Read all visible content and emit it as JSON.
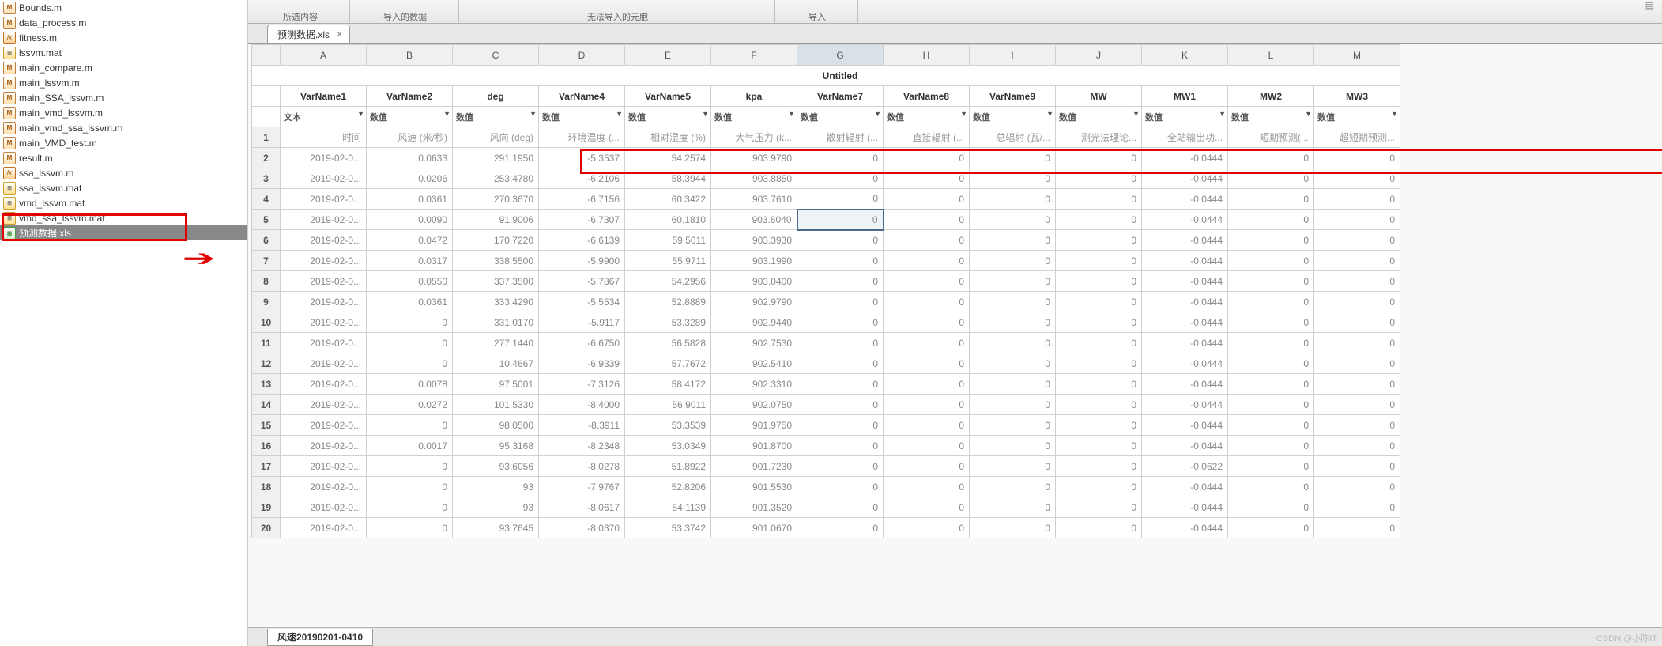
{
  "files": [
    {
      "name": "Bounds.m",
      "icon": "m"
    },
    {
      "name": "data_process.m",
      "icon": "m"
    },
    {
      "name": "fitness.m",
      "icon": "fx"
    },
    {
      "name": "lssvm.mat",
      "icon": "mat"
    },
    {
      "name": "main_compare.m",
      "icon": "m"
    },
    {
      "name": "main_lssvm.m",
      "icon": "m"
    },
    {
      "name": "main_SSA_lssvm.m",
      "icon": "m"
    },
    {
      "name": "main_vmd_lssvm.m",
      "icon": "m"
    },
    {
      "name": "main_vmd_ssa_lssvm.m",
      "icon": "m"
    },
    {
      "name": "main_VMD_test.m",
      "icon": "m"
    },
    {
      "name": "result.m",
      "icon": "m"
    },
    {
      "name": "ssa_lssvm.m",
      "icon": "fx"
    },
    {
      "name": "ssa_lssvm.mat",
      "icon": "mat"
    },
    {
      "name": "vmd_lssvm.mat",
      "icon": "mat"
    },
    {
      "name": "vmd_ssa_lssvm.mat",
      "icon": "mat"
    },
    {
      "name": "预测数据.xls",
      "icon": "xls",
      "selected": true
    }
  ],
  "toolstrip": {
    "group1": "所选内容",
    "group2": "导入的数据",
    "group3": "无法导入的元胞",
    "group4": "导入",
    "right_icon": "▤"
  },
  "tab": {
    "name": "预测数据.xls",
    "close": "✕"
  },
  "sheet": {
    "col_letters": [
      "A",
      "B",
      "C",
      "D",
      "E",
      "F",
      "G",
      "H",
      "I",
      "J",
      "K",
      "L",
      "M"
    ],
    "selected_col_index": 6,
    "untitled": "Untitled",
    "var_names": [
      "VarName1",
      "VarName2",
      "deg",
      "VarName4",
      "VarName5",
      "kpa",
      "VarName7",
      "VarName8",
      "VarName9",
      "MW",
      "MW1",
      "MW2",
      "MW3"
    ],
    "types": [
      "文本",
      "数值",
      "数值",
      "数值",
      "数值",
      "数值",
      "数值",
      "数值",
      "数值",
      "数值",
      "数值",
      "数值",
      "数值"
    ],
    "header_row": [
      "时间",
      "风速 (米/秒)",
      "风向 (deg)",
      "环境温度 (...",
      "相对湿度 (%)",
      "大气压力 (k...",
      "散射辐射 (...",
      "直接辐射 (...",
      "总辐射 (瓦/...",
      "测光法理论...",
      "全站输出功...",
      "短期预测(...",
      "超短期预测..."
    ],
    "rows": [
      [
        "2019-02-0...",
        "0.0633",
        "291.1950",
        "-5.3537",
        "54.2574",
        "903.9790",
        "0",
        "0",
        "0",
        "0",
        "-0.0444",
        "0",
        "0"
      ],
      [
        "2019-02-0...",
        "0.0206",
        "253.4780",
        "-6.2106",
        "58.3944",
        "903.8850",
        "0",
        "0",
        "0",
        "0",
        "-0.0444",
        "0",
        "0"
      ],
      [
        "2019-02-0...",
        "0.0361",
        "270.3670",
        "-6.7156",
        "60.3422",
        "903.7610",
        "0",
        "0",
        "0",
        "0",
        "-0.0444",
        "0",
        "0"
      ],
      [
        "2019-02-0...",
        "0.0090",
        "91.9006",
        "-6.7307",
        "60.1810",
        "903.6040",
        "0",
        "0",
        "0",
        "0",
        "-0.0444",
        "0",
        "0"
      ],
      [
        "2019-02-0...",
        "0.0472",
        "170.7220",
        "-6.6139",
        "59.5011",
        "903.3930",
        "0",
        "0",
        "0",
        "0",
        "-0.0444",
        "0",
        "0"
      ],
      [
        "2019-02-0...",
        "0.0317",
        "338.5500",
        "-5.9900",
        "55.9711",
        "903.1990",
        "0",
        "0",
        "0",
        "0",
        "-0.0444",
        "0",
        "0"
      ],
      [
        "2019-02-0...",
        "0.0550",
        "337.3500",
        "-5.7867",
        "54.2956",
        "903.0400",
        "0",
        "0",
        "0",
        "0",
        "-0.0444",
        "0",
        "0"
      ],
      [
        "2019-02-0...",
        "0.0361",
        "333.4290",
        "-5.5534",
        "52.8889",
        "902.9790",
        "0",
        "0",
        "0",
        "0",
        "-0.0444",
        "0",
        "0"
      ],
      [
        "2019-02-0...",
        "0",
        "331.0170",
        "-5.9117",
        "53.3289",
        "902.9440",
        "0",
        "0",
        "0",
        "0",
        "-0.0444",
        "0",
        "0"
      ],
      [
        "2019-02-0...",
        "0",
        "277.1440",
        "-6.6750",
        "56.5828",
        "902.7530",
        "0",
        "0",
        "0",
        "0",
        "-0.0444",
        "0",
        "0"
      ],
      [
        "2019-02-0...",
        "0",
        "10.4667",
        "-6.9339",
        "57.7672",
        "902.5410",
        "0",
        "0",
        "0",
        "0",
        "-0.0444",
        "0",
        "0"
      ],
      [
        "2019-02-0...",
        "0.0078",
        "97.5001",
        "-7.3126",
        "58.4172",
        "902.3310",
        "0",
        "0",
        "0",
        "0",
        "-0.0444",
        "0",
        "0"
      ],
      [
        "2019-02-0...",
        "0.0272",
        "101.5330",
        "-8.4000",
        "56.9011",
        "902.0750",
        "0",
        "0",
        "0",
        "0",
        "-0.0444",
        "0",
        "0"
      ],
      [
        "2019-02-0...",
        "0",
        "98.0500",
        "-8.3911",
        "53.3539",
        "901.9750",
        "0",
        "0",
        "0",
        "0",
        "-0.0444",
        "0",
        "0"
      ],
      [
        "2019-02-0...",
        "0.0017",
        "95.3168",
        "-8.2348",
        "53.0349",
        "901.8700",
        "0",
        "0",
        "0",
        "0",
        "-0.0444",
        "0",
        "0"
      ],
      [
        "2019-02-0...",
        "0",
        "93.6056",
        "-8.0278",
        "51.8922",
        "901.7230",
        "0",
        "0",
        "0",
        "0",
        "-0.0622",
        "0",
        "0"
      ],
      [
        "2019-02-0...",
        "0",
        "93",
        "-7.9767",
        "52.8206",
        "901.5530",
        "0",
        "0",
        "0",
        "0",
        "-0.0444",
        "0",
        "0"
      ],
      [
        "2019-02-0...",
        "0",
        "93",
        "-8.0617",
        "54.1139",
        "901.3520",
        "0",
        "0",
        "0",
        "0",
        "-0.0444",
        "0",
        "0"
      ],
      [
        "2019-02-0...",
        "0",
        "93.7645",
        "-8.0370",
        "53.3742",
        "901.0670",
        "0",
        "0",
        "0",
        "0",
        "-0.0444",
        "0",
        "0"
      ]
    ],
    "active_cell": {
      "row_index": 3,
      "col_index": 6
    },
    "bottom_tab": "风速20190201-0410"
  },
  "watermark": "CSDN @小陈IT"
}
